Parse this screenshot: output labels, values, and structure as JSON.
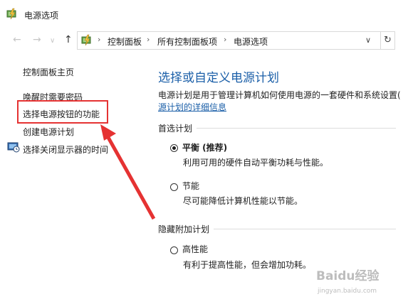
{
  "window": {
    "title": "电源选项"
  },
  "address": {
    "crumbs": [
      "控制面板",
      "所有控制面板项",
      "电源选项"
    ],
    "nav": {
      "back": "←",
      "forward": "→",
      "up": "↑",
      "dropdown": "∨",
      "refresh": "↻"
    }
  },
  "sidebar": {
    "home": "控制面板主页",
    "items": [
      "唤醒时需要密码",
      "选择电源按钮的功能",
      "创建电源计划",
      "选择关闭显示器的时间"
    ]
  },
  "main": {
    "title": "选择或自定义电源计划",
    "description": "电源计划是用于管理计算机如何使用电源的一套硬件和系统设置(",
    "link": "源计划的详细信息",
    "preferred_label": "首选计划",
    "hidden_label": "隐藏附加计划",
    "plans": [
      {
        "name": "平衡 (推荐)",
        "desc": "利用可用的硬件自动平衡功耗与性能。",
        "checked": true
      },
      {
        "name": "节能",
        "desc": "尽可能降低计算机性能以节能。",
        "checked": false
      },
      {
        "name": "高性能",
        "desc": "有利于提高性能，但会增加功耗。",
        "checked": false
      }
    ]
  },
  "watermark": {
    "text": "Baidu经验",
    "sub": "jingyan.baidu.com"
  },
  "colors": {
    "accent": "#1b5fa8",
    "annotation": "#e53232"
  }
}
